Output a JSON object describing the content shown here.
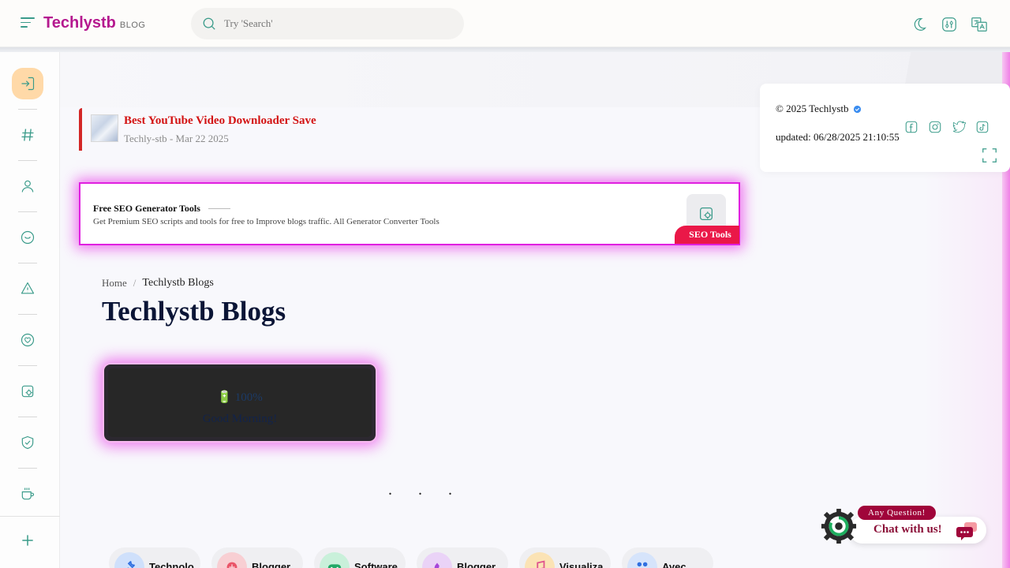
{
  "header": {
    "logo_main": "Techlystb",
    "logo_sub": "BLOG",
    "search_placeholder": "Try 'Search'",
    "icons": [
      "moon-icon",
      "settings-sliders-icon",
      "translate-icon"
    ]
  },
  "sidebar": {
    "items": [
      "login-icon",
      "hashtag-icon",
      "user-icon",
      "inbox-icon",
      "alert-icon",
      "heart-icon",
      "gear-icon",
      "shield-check-icon",
      "coffee-icon"
    ],
    "bottom": "plus-icon"
  },
  "post": {
    "title": "Best YouTube Video Downloader Save",
    "author": "Techly-stb",
    "sep": "-",
    "date": "Mar 22 2025"
  },
  "seo_card": {
    "title": "Free SEO Generator Tools",
    "description": "Get Premium SEO scripts and tools for free to Improve blogs traffic. All Generator Converter Tools",
    "tag": "SEO Tools"
  },
  "breadcrumb": {
    "home": "Home",
    "sep": "/",
    "current": "Techlystb Blogs"
  },
  "page_title": "Techlystb Blogs",
  "greeting": {
    "battery": "🔋 100%",
    "message": "Good Morning!"
  },
  "loading_dots": ". . .",
  "categories": [
    "Technolo",
    "Blogger",
    "Software",
    "Blogger",
    "Visualiza",
    "Ayec"
  ],
  "info": {
    "copyright": "© 2025 Techlystb",
    "updated": "updated: 06/28/2025 21:10:55",
    "socials": [
      "facebook-icon",
      "instagram-icon",
      "twitter-icon",
      "tiktok-icon"
    ]
  },
  "chat": {
    "badge": "Any Question!",
    "label": "Chat with us!"
  },
  "colors": {
    "accent": "#b5198f",
    "icon": "#3a9b8a",
    "seo_tag": "#ea1848",
    "post_title": "#d31313",
    "chat": "#8b1038"
  }
}
